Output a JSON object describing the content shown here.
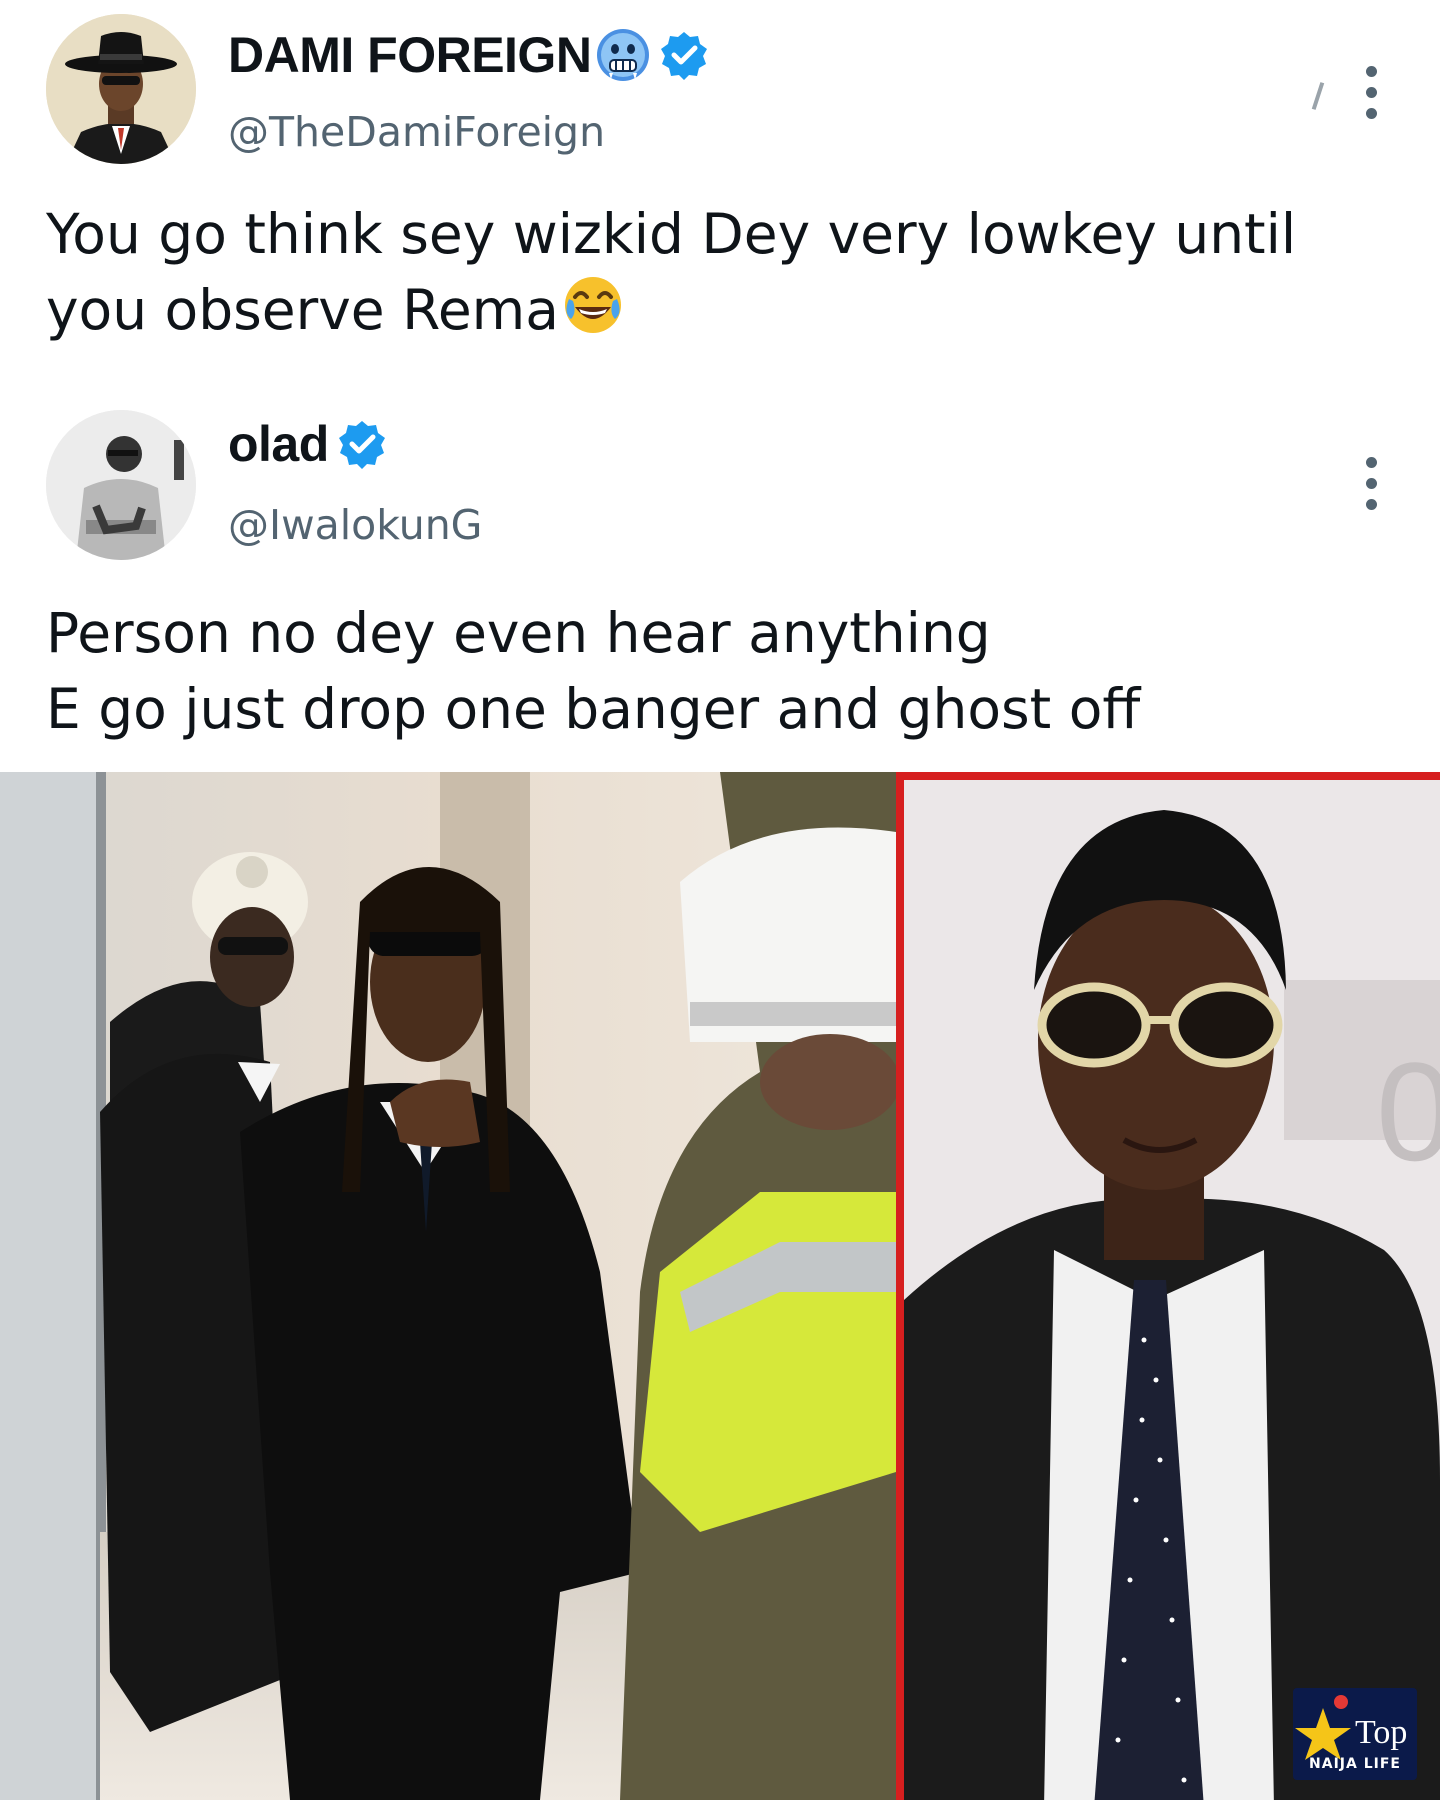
{
  "tweets": [
    {
      "display_name": "DAMI FOREIGN",
      "handle": "@TheDamiForeign",
      "name_emoji": "cold-face-emoji",
      "verified": true,
      "text_lines": [
        "You go think sey wizkid Dey very lowkey until",
        "you observe Rema"
      ],
      "trailing_emoji": "tears-of-joy-emoji"
    },
    {
      "display_name": "olad",
      "handle": "@IwalokunG",
      "verified": true,
      "text_lines": [
        "Person no dey even hear anything",
        "E go just drop one banger and ghost off"
      ]
    }
  ],
  "icons": {
    "verified": "verified-badge-icon",
    "more": "more-options-icon"
  },
  "colors": {
    "verified_blue": "#1d9bf0",
    "handle_gray": "#536471",
    "frame_red": "#d61f1f",
    "logo_navy": "#0b1a4a"
  },
  "watermark": {
    "brand_mark": "Top",
    "subtitle": "NAIJA LIFE"
  }
}
